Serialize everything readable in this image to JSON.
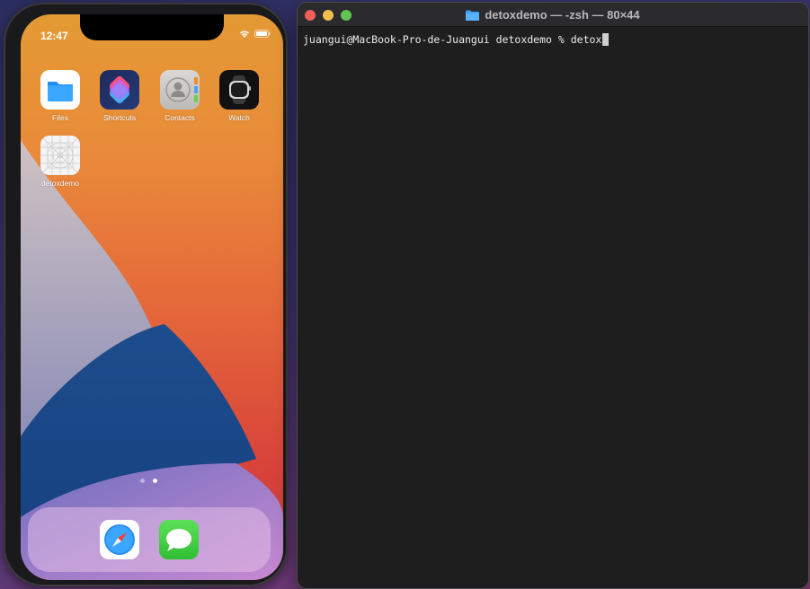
{
  "simulator": {
    "status_time": "12:47",
    "apps": [
      {
        "label": "Files",
        "icon": "files-icon"
      },
      {
        "label": "Shortcuts",
        "icon": "shortcuts-icon"
      },
      {
        "label": "Contacts",
        "icon": "contacts-icon"
      },
      {
        "label": "Watch",
        "icon": "watch-icon"
      },
      {
        "label": "detoxdemo",
        "icon": "app-placeholder-icon"
      }
    ],
    "dock": [
      {
        "name": "Safari",
        "icon": "safari-icon"
      },
      {
        "name": "Messages",
        "icon": "messages-icon"
      }
    ],
    "page_count": 2,
    "current_page": 2
  },
  "terminal": {
    "title": "detoxdemo — -zsh — 80×44",
    "prompt": "juangui@MacBook-Pro-de-Juangui detoxdemo % ",
    "input": "detox"
  },
  "colors": {
    "terminal_bg": "#1e1e1e",
    "close": "#ee5f57",
    "minimize": "#f4be4f",
    "maximize": "#61c554"
  }
}
